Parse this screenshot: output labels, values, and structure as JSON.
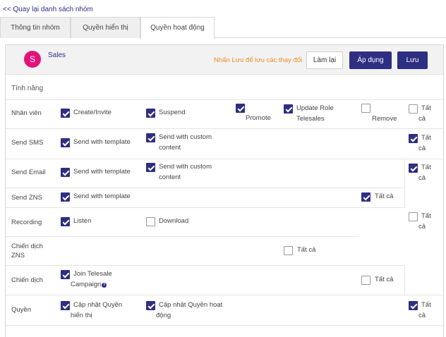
{
  "back_link": "<< Quay lại danh sách nhóm",
  "tabs": [
    "Thông tin nhóm",
    "Quyền hiển thị",
    "Quyền hoạt động"
  ],
  "group": {
    "avatar_letter": "S",
    "name": "Sales",
    "avatar_color": "#e3127a"
  },
  "hint": "Nhấn Lưu để lưu các thay đổi",
  "buttons": {
    "reset": "Làm lại",
    "apply": "Áp dụng",
    "save": "Lưu"
  },
  "feature_title": "Tính năng",
  "rows": {
    "employee": {
      "label": "Nhân viên",
      "create": "Create/Invite",
      "suspend": "Suspend",
      "promote": "Promote",
      "update_role_1": "Update Role",
      "update_role_2": "Telesales",
      "remove": "Remove",
      "all_1": "Tất",
      "all_2": "cả"
    },
    "sms": {
      "label": "Send SMS",
      "template": "Send with template",
      "custom_1": "Send with custom",
      "custom_2": "content",
      "all_1": "Tất",
      "all_2": "cả"
    },
    "email": {
      "label": "Send Email",
      "template": "Send with template",
      "custom_1": "Send with custom",
      "custom_2": "content"
    },
    "email_zns_all": {
      "all_1": "Tất",
      "all_2": "cả"
    },
    "zns": {
      "label": "Send ZNS",
      "template": "Send with template",
      "all": "Tất cả"
    },
    "recording": {
      "label": "Recording",
      "listen": "Listen",
      "download": "Download",
      "all_1": "Tất",
      "all_2": "cả"
    },
    "campaign_zns": {
      "label_1": "Chiến dịch",
      "label_2": "ZNS",
      "all": "Tất cả"
    },
    "campaign": {
      "label": "Chiến dịch",
      "join_1": "Join Telesale",
      "join_2": "Campaign",
      "all": "Tất cả"
    },
    "permission": {
      "label": "Quyền",
      "display_1": "Cập nhật Quyền",
      "display_2": "hiển thị",
      "activity_1": "Cập nhật Quyền hoạt",
      "activity_2": "động",
      "all_1": "Tất",
      "all_2": "cả"
    }
  },
  "colors": {
    "accent": "#2e2e82",
    "hint": "#f08a24",
    "link": "#2b2b8c"
  }
}
